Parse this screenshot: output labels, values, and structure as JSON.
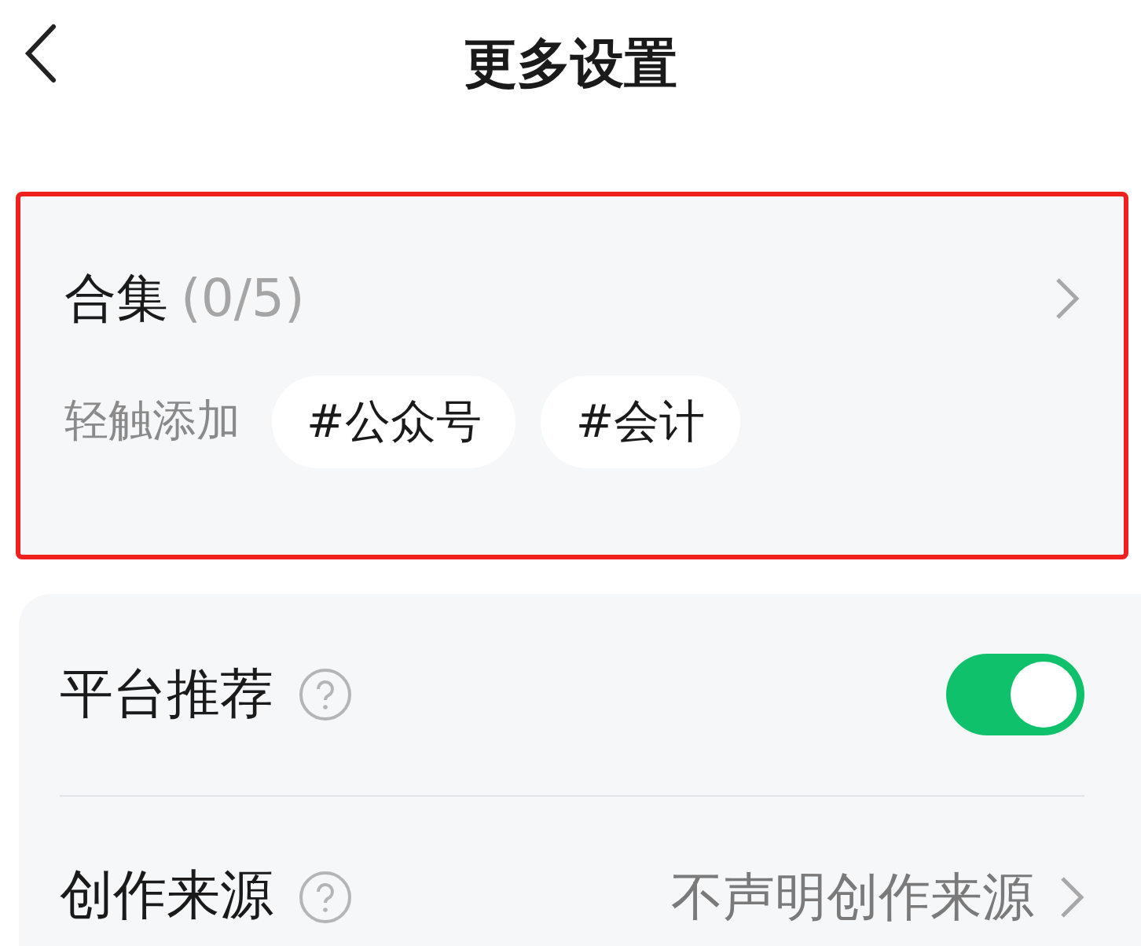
{
  "header": {
    "title": "更多设置"
  },
  "collection": {
    "highlighted": true,
    "title": "合集",
    "count": "(0/5)",
    "hint": "轻触添加",
    "tags": [
      "#公众号",
      "#会计"
    ]
  },
  "settings": [
    {
      "kind": "toggle",
      "label": "平台推荐",
      "on": true
    },
    {
      "kind": "select",
      "label": "创作来源",
      "value": "不声明创作来源"
    }
  ]
}
